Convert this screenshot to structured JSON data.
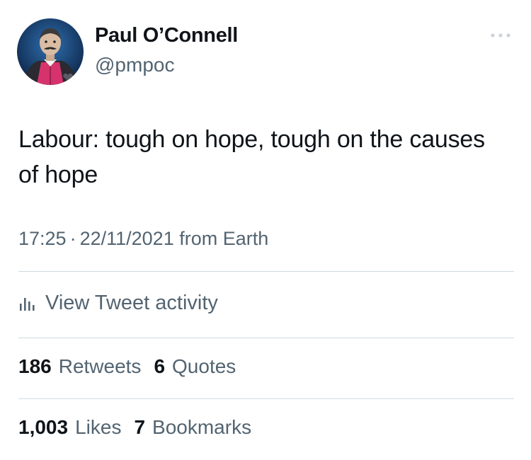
{
  "author": {
    "name": "Paul O’Connell",
    "handle": "@pmpoc"
  },
  "tweet": {
    "text": "Labour: tough on hope, tough on the causes of hope",
    "time": "17:25",
    "date": "22/11/2021",
    "source": "from Earth",
    "separator": "·"
  },
  "activity": {
    "label": "View Tweet activity",
    "icon": "bar-chart-icon"
  },
  "stats": {
    "retweets_count": "186",
    "retweets_label": "Retweets",
    "quotes_count": "6",
    "quotes_label": "Quotes",
    "likes_count": "1,003",
    "likes_label": "Likes",
    "bookmarks_count": "7",
    "bookmarks_label": "Bookmarks"
  },
  "colors": {
    "primary_text": "#0f1419",
    "secondary_text": "#536471",
    "divider": "#cfd9de",
    "avatar_background": "#1a3f6e",
    "avatar_accent": "#d6336c"
  }
}
